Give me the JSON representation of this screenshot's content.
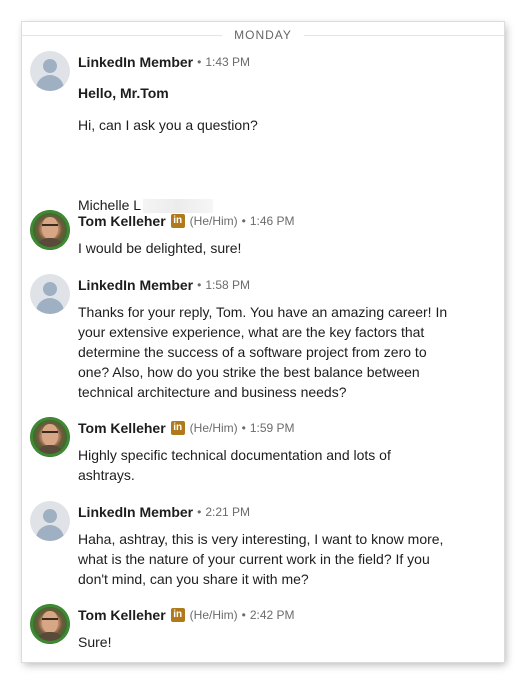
{
  "day_label": "MONDAY",
  "messages": [
    {
      "sender": "LinkedIn Member",
      "time": "1:43 PM",
      "lines": [
        "Hello, Mr.Tom",
        "Hi, can I ask you a question?",
        "Michelle L"
      ]
    },
    {
      "sender": "Tom Kelleher",
      "badge": "in",
      "pronoun": "(He/Him)",
      "time": "1:46 PM",
      "lines": [
        "I would be delighted, sure!"
      ]
    },
    {
      "sender": "LinkedIn Member",
      "time": "1:58 PM",
      "lines": [
        "Thanks for your reply, Tom. You have an amazing career! In",
        "your extensive experience, what are the key factors that",
        "determine the success of a software project from zero to",
        "one? Also, how do you strike the best balance between",
        "technical architecture and business needs?"
      ]
    },
    {
      "sender": "Tom Kelleher",
      "badge": "in",
      "pronoun": "(He/Him)",
      "time": "1:59 PM",
      "lines": [
        "Highly specific technical documentation and lots of",
        "ashtrays."
      ]
    },
    {
      "sender": "LinkedIn Member",
      "time": "2:21 PM",
      "lines": [
        "Haha, ashtray, this is very interesting, I want to know more,",
        "what is the nature of your current work in the field? If you",
        "don't mind, can you share it with me?"
      ]
    },
    {
      "sender": "Tom Kelleher",
      "badge": "in",
      "pronoun": "(He/Him)",
      "time": "2:42 PM",
      "lines": [
        "Sure!"
      ]
    }
  ],
  "icons": {
    "member_avatar": "default-member-avatar-icon",
    "tom_avatar": "profile-photo-avatar",
    "badge": "linkedin-premium-badge-icon"
  },
  "colors": {
    "badge": "#b07a1c",
    "meta_text": "#6b6b6b",
    "body_text": "#1d1d1d"
  }
}
